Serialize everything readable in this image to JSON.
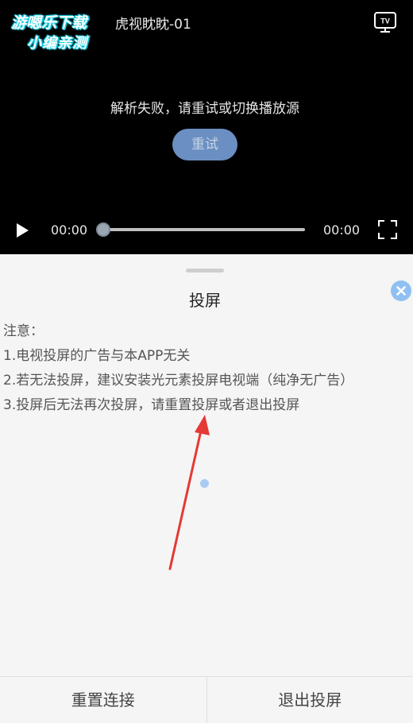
{
  "player": {
    "watermark_line1": "游嗯乐下载",
    "watermark_line2": "小编亲测",
    "title": "虎视眈眈-01",
    "tv_icon_label": "TV",
    "error_message": "解析失败，请重试或切换播放源",
    "retry_label": "重试",
    "current_time": "00:00",
    "total_time": "00:00",
    "progress": 0,
    "icons": [
      "tv-icon",
      "play-icon",
      "fullscreen-icon"
    ]
  },
  "sheet": {
    "title": "投屏",
    "notice_lines": [
      "注意：",
      "1.电视投屏的广告与本APP无关",
      "2.若无法投屏，建议安装光元素投屏电视端（纯净无广告）",
      "3.投屏后无法再次投屏，请重置投屏或者退出投屏"
    ],
    "reset_label": "重置连接",
    "exit_label": "退出投屏",
    "icons": [
      "close-icon"
    ]
  },
  "colors": {
    "accent": "#8fc0f2",
    "retry_button": "#6b8fc2",
    "annotation_arrow": "#e53935",
    "watermark_glow": "#18d2e6"
  }
}
